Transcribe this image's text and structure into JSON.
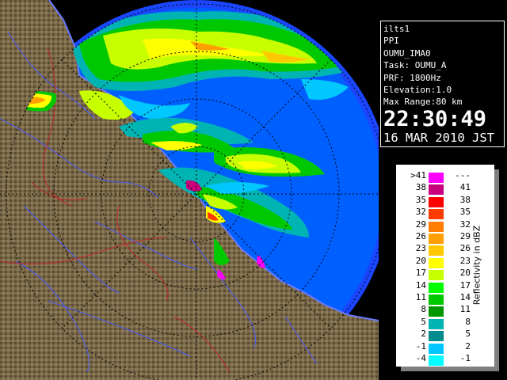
{
  "info": {
    "lines": [
      "ilts1",
      "PPI",
      "OUMU_IMA0",
      "Task: OUMU_A",
      "PRF: 1800Hz",
      "Elevation:1.0",
      "Max Range:80 km"
    ],
    "time": "22:30:49",
    "date": "16 MAR 2010 JST"
  },
  "scale": {
    "label": "Reflectivity in dBZ",
    "rows": [
      {
        "lo": ">41",
        "hi": "---",
        "color": "#ff00ff"
      },
      {
        "lo": "38",
        "hi": "41",
        "color": "#c8007c"
      },
      {
        "lo": "35",
        "hi": "38",
        "color": "#ff0000"
      },
      {
        "lo": "32",
        "hi": "35",
        "color": "#ff3b00"
      },
      {
        "lo": "29",
        "hi": "32",
        "color": "#ff7d00"
      },
      {
        "lo": "26",
        "hi": "29",
        "color": "#ffa000"
      },
      {
        "lo": "23",
        "hi": "26",
        "color": "#ffc800"
      },
      {
        "lo": "20",
        "hi": "23",
        "color": "#ffff00"
      },
      {
        "lo": "17",
        "hi": "20",
        "color": "#c8ff00"
      },
      {
        "lo": "14",
        "hi": "17",
        "color": "#00ff00"
      },
      {
        "lo": "11",
        "hi": "14",
        "color": "#00c800"
      },
      {
        "lo": "8",
        "hi": "11",
        "color": "#009600"
      },
      {
        "lo": "5",
        "hi": "8",
        "color": "#00b4b4"
      },
      {
        "lo": "2",
        "hi": "5",
        "color": "#008c8c"
      },
      {
        "lo": "-1",
        "hi": "2",
        "color": "#00c8ff"
      },
      {
        "lo": "-4",
        "hi": "-1",
        "color": "#00ffff"
      }
    ]
  },
  "colors": {
    "range_disk": "#1a46ff",
    "range_disk_outer": "#0060ff",
    "land": "#7a6a4a",
    "land_dark": "#4a3c28",
    "coast": "#5a6aff",
    "rivers": "#3a4aff",
    "borders": "#cc2a2a",
    "rings": "#000000"
  }
}
